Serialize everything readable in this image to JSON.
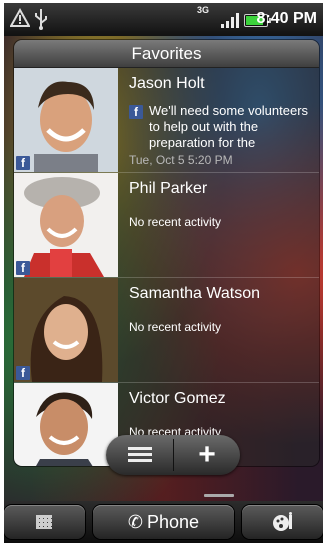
{
  "statusbar": {
    "network_label": "3G",
    "time": "8:40 PM",
    "battery_fraction": 0.85,
    "signal_bars": 4
  },
  "widget": {
    "title": "Favorites",
    "contacts": [
      {
        "name": "Jason Holt",
        "status": "We'll need some volunteers to help out with the preparation for the",
        "timestamp": "Tue, Oct 5 5:20 PM",
        "source_icon": "facebook-icon"
      },
      {
        "name": "Phil Parker",
        "activity": "No recent activity",
        "source_icon": "facebook-icon"
      },
      {
        "name": "Samantha Watson",
        "activity": "No recent activity",
        "source_icon": "facebook-icon"
      },
      {
        "name": "Victor Gomez",
        "activity": "No recent activity"
      }
    ]
  },
  "floating": {
    "menu_icon": "menu-icon",
    "add_label": "+"
  },
  "dock": {
    "phone_label": "Phone",
    "apps_icon": "all-apps-icon",
    "personalize_icon": "personalize-icon"
  },
  "colors": {
    "facebook": "#3b5998",
    "battery": "#3cd23c"
  }
}
